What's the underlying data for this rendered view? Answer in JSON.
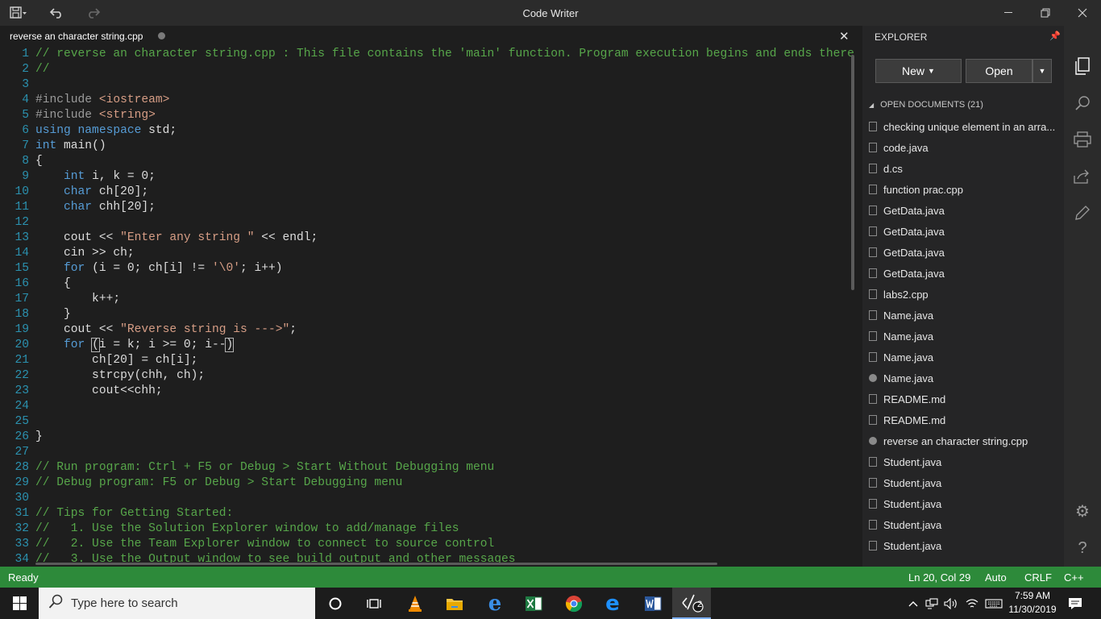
{
  "window": {
    "title": "Code Writer"
  },
  "tab": {
    "title": "reverse an character string.cpp"
  },
  "code_lines": [
    {
      "n": "1",
      "html": "<span class=\"cm\">// reverse an character string.cpp : This file contains the 'main' function. Program execution begins and ends there</span>"
    },
    {
      "n": "2",
      "html": "<span class=\"cm\">//</span>"
    },
    {
      "n": "3",
      "html": ""
    },
    {
      "n": "4",
      "html": "<span class=\"pp\">#include</span> <span class=\"str\">&lt;iostream&gt;</span>"
    },
    {
      "n": "5",
      "html": "<span class=\"pp\">#include</span> <span class=\"str\">&lt;string&gt;</span>"
    },
    {
      "n": "6",
      "html": "<span class=\"kw\">using namespace</span> std;"
    },
    {
      "n": "7",
      "html": "<span class=\"kw\">int</span> main()"
    },
    {
      "n": "8",
      "html": "{"
    },
    {
      "n": "9",
      "html": "    <span class=\"kw\">int</span> i, k = 0;"
    },
    {
      "n": "10",
      "html": "    <span class=\"kw\">char</span> ch[20];"
    },
    {
      "n": "11",
      "html": "    <span class=\"kw\">char</span> chh[20];"
    },
    {
      "n": "12",
      "html": ""
    },
    {
      "n": "13",
      "html": "    cout &lt;&lt; <span class=\"str\">\"Enter any string \"</span> &lt;&lt; endl;"
    },
    {
      "n": "14",
      "html": "    cin &gt;&gt; ch;"
    },
    {
      "n": "15",
      "html": "    <span class=\"kw\">for</span> (i = 0; ch[i] != <span class=\"str\">'\\0'</span>; i++)"
    },
    {
      "n": "16",
      "html": "    {"
    },
    {
      "n": "17",
      "html": "        k++;"
    },
    {
      "n": "18",
      "html": "    }"
    },
    {
      "n": "19",
      "html": "    cout &lt;&lt; <span class=\"str\">\"Reverse string is ---&gt;\"</span>;"
    },
    {
      "n": "20",
      "html": "    <span class=\"kw\">for</span> <span class=\"caret-box\">(</span>i = k; i &gt;= 0; i--<span class=\"caret-box\">)</span>"
    },
    {
      "n": "21",
      "html": "        ch[20] = ch[i];"
    },
    {
      "n": "22",
      "html": "        strcpy(chh, ch);"
    },
    {
      "n": "23",
      "html": "        cout&lt;&lt;chh;"
    },
    {
      "n": "24",
      "html": ""
    },
    {
      "n": "25",
      "html": ""
    },
    {
      "n": "26",
      "html": "}"
    },
    {
      "n": "27",
      "html": ""
    },
    {
      "n": "28",
      "html": "<span class=\"cm\">// Run program: Ctrl + F5 or Debug &gt; Start Without Debugging menu</span>"
    },
    {
      "n": "29",
      "html": "<span class=\"cm\">// Debug program: F5 or Debug &gt; Start Debugging menu</span>"
    },
    {
      "n": "30",
      "html": ""
    },
    {
      "n": "31",
      "html": "<span class=\"cm\">// Tips for Getting Started:</span>"
    },
    {
      "n": "32",
      "html": "<span class=\"cm\">//   1. Use the Solution Explorer window to add/manage files</span>"
    },
    {
      "n": "33",
      "html": "<span class=\"cm\">//   2. Use the Team Explorer window to connect to source control</span>"
    },
    {
      "n": "34",
      "html": "<span class=\"cm\">//   3. Use the Output window to see build output and other messages</span>"
    }
  ],
  "explorer": {
    "title": "EXPLORER",
    "new_label": "New",
    "open_label": "Open",
    "section_label": "OPEN DOCUMENTS (21)",
    "documents": [
      {
        "name": "checking unique element in an arra...",
        "modified": false
      },
      {
        "name": "code.java",
        "modified": false
      },
      {
        "name": "d.cs",
        "modified": false
      },
      {
        "name": "function prac.cpp",
        "modified": false
      },
      {
        "name": "GetData.java",
        "modified": false
      },
      {
        "name": "GetData.java",
        "modified": false
      },
      {
        "name": "GetData.java",
        "modified": false
      },
      {
        "name": "GetData.java",
        "modified": false
      },
      {
        "name": "labs2.cpp",
        "modified": false
      },
      {
        "name": "Name.java",
        "modified": false
      },
      {
        "name": "Name.java",
        "modified": false
      },
      {
        "name": "Name.java",
        "modified": false
      },
      {
        "name": "Name.java",
        "modified": true
      },
      {
        "name": "README.md",
        "modified": false
      },
      {
        "name": "README.md",
        "modified": false
      },
      {
        "name": "reverse an character string.cpp",
        "modified": true
      },
      {
        "name": "Student.java",
        "modified": false
      },
      {
        "name": "Student.java",
        "modified": false
      },
      {
        "name": "Student.java",
        "modified": false
      },
      {
        "name": "Student.java",
        "modified": false
      },
      {
        "name": "Student.java",
        "modified": false
      }
    ]
  },
  "status": {
    "state": "Ready",
    "position": "Ln 20, Col 29",
    "indent": "Auto",
    "eol": "CRLF",
    "language": "C++"
  },
  "taskbar": {
    "search_placeholder": "Type here to search",
    "time": "7:59 AM",
    "date": "11/30/2019",
    "badge": "2"
  },
  "colors": {
    "status_bar": "#2d8a3a",
    "comment": "#57a64a",
    "keyword": "#569cd6",
    "string": "#d69d85",
    "line_number": "#2b91af"
  }
}
